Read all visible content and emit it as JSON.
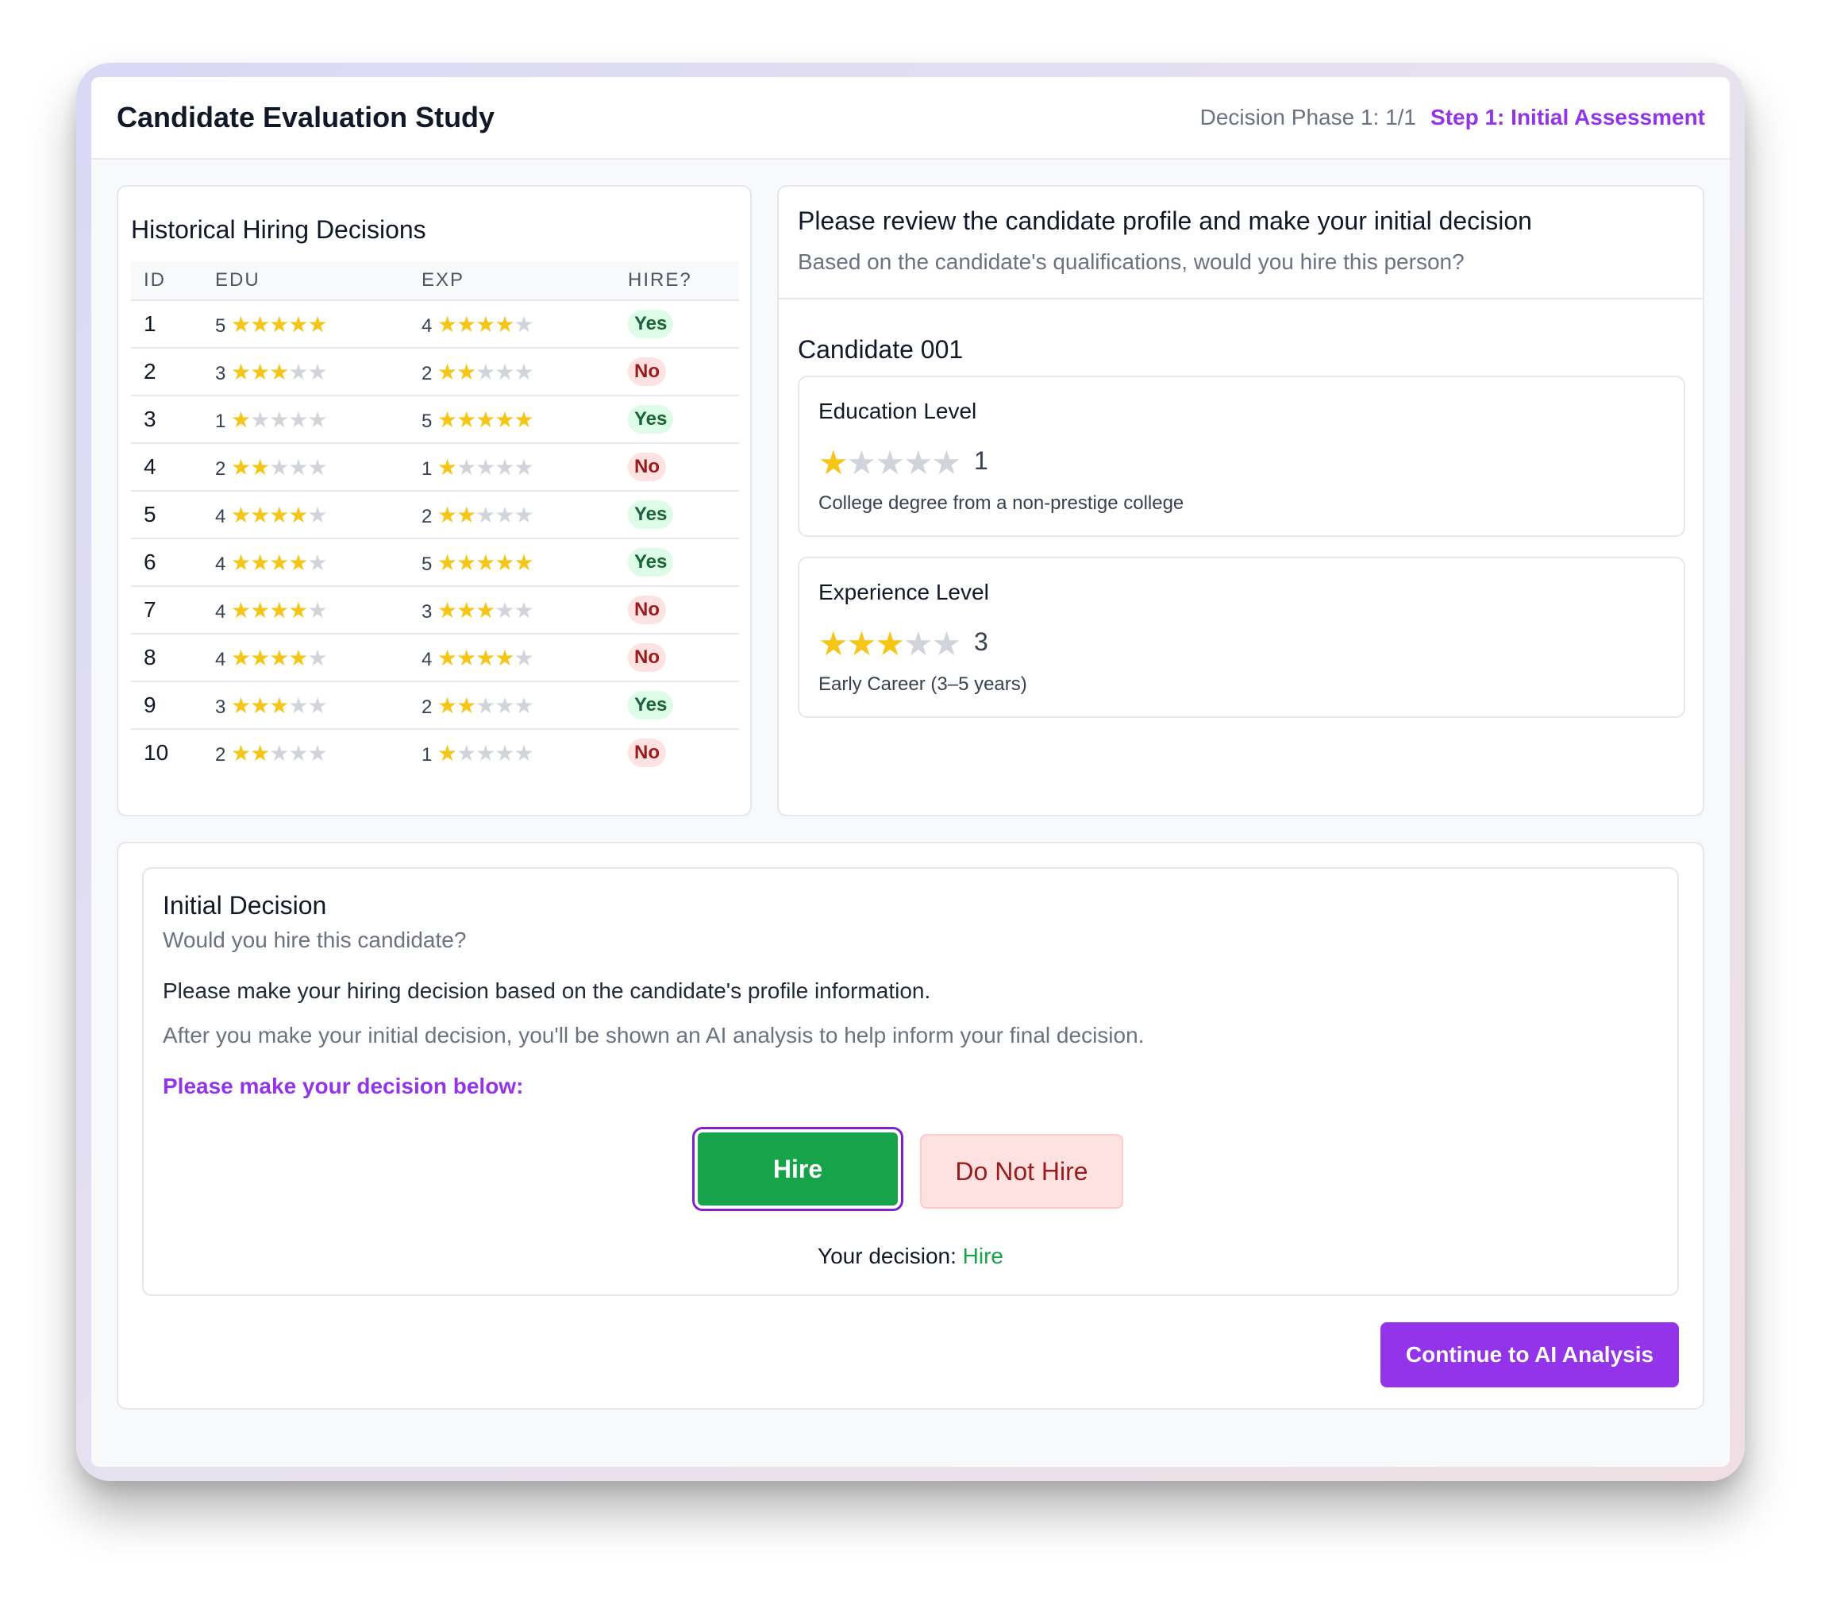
{
  "header": {
    "title": "Candidate Evaluation Study",
    "phase": "Decision Phase 1: 1/1",
    "step": "Step 1: Initial Assessment"
  },
  "history": {
    "title": "Historical Hiring Decisions",
    "columns": [
      "ID",
      "EDU",
      "EXP",
      "HIRE?"
    ],
    "rows": [
      {
        "id": "1",
        "edu": 5,
        "exp": 4,
        "hire": "Yes"
      },
      {
        "id": "2",
        "edu": 3,
        "exp": 2,
        "hire": "No"
      },
      {
        "id": "3",
        "edu": 1,
        "exp": 5,
        "hire": "Yes"
      },
      {
        "id": "4",
        "edu": 2,
        "exp": 1,
        "hire": "No"
      },
      {
        "id": "5",
        "edu": 4,
        "exp": 2,
        "hire": "Yes"
      },
      {
        "id": "6",
        "edu": 4,
        "exp": 5,
        "hire": "Yes"
      },
      {
        "id": "7",
        "edu": 4,
        "exp": 3,
        "hire": "No"
      },
      {
        "id": "8",
        "edu": 4,
        "exp": 4,
        "hire": "No"
      },
      {
        "id": "9",
        "edu": 3,
        "exp": 2,
        "hire": "Yes"
      },
      {
        "id": "10",
        "edu": 2,
        "exp": 1,
        "hire": "No"
      }
    ]
  },
  "review": {
    "title": "Please review the candidate profile and make your initial decision",
    "subtitle": "Based on the candidate's qualifications, would you hire this person?",
    "candidate": "Candidate 001",
    "education": {
      "label": "Education Level",
      "rating": 1,
      "value": "1",
      "description": "College degree from a non-prestige college"
    },
    "experience": {
      "label": "Experience Level",
      "rating": 3,
      "value": "3",
      "description": "Early Career (3–5 years)"
    }
  },
  "decision": {
    "title": "Initial Decision",
    "question": "Would you hire this candidate?",
    "text1": "Please make your hiring decision based on the candidate's profile information.",
    "text2": "After you make your initial decision, you'll be shown an AI analysis to help inform your final decision.",
    "prompt": "Please make your decision below:",
    "hire_label": "Hire",
    "no_hire_label": "Do Not Hire",
    "your_decision_label": "Your decision:",
    "your_decision_value": "Hire",
    "continue_label": "Continue to AI Analysis"
  },
  "colors": {
    "accent": "#9333ea",
    "hire_green": "#16a34a",
    "star_gold": "#f5c518",
    "star_gray": "#d1d5db"
  },
  "icons": {
    "star": "star-icon"
  }
}
